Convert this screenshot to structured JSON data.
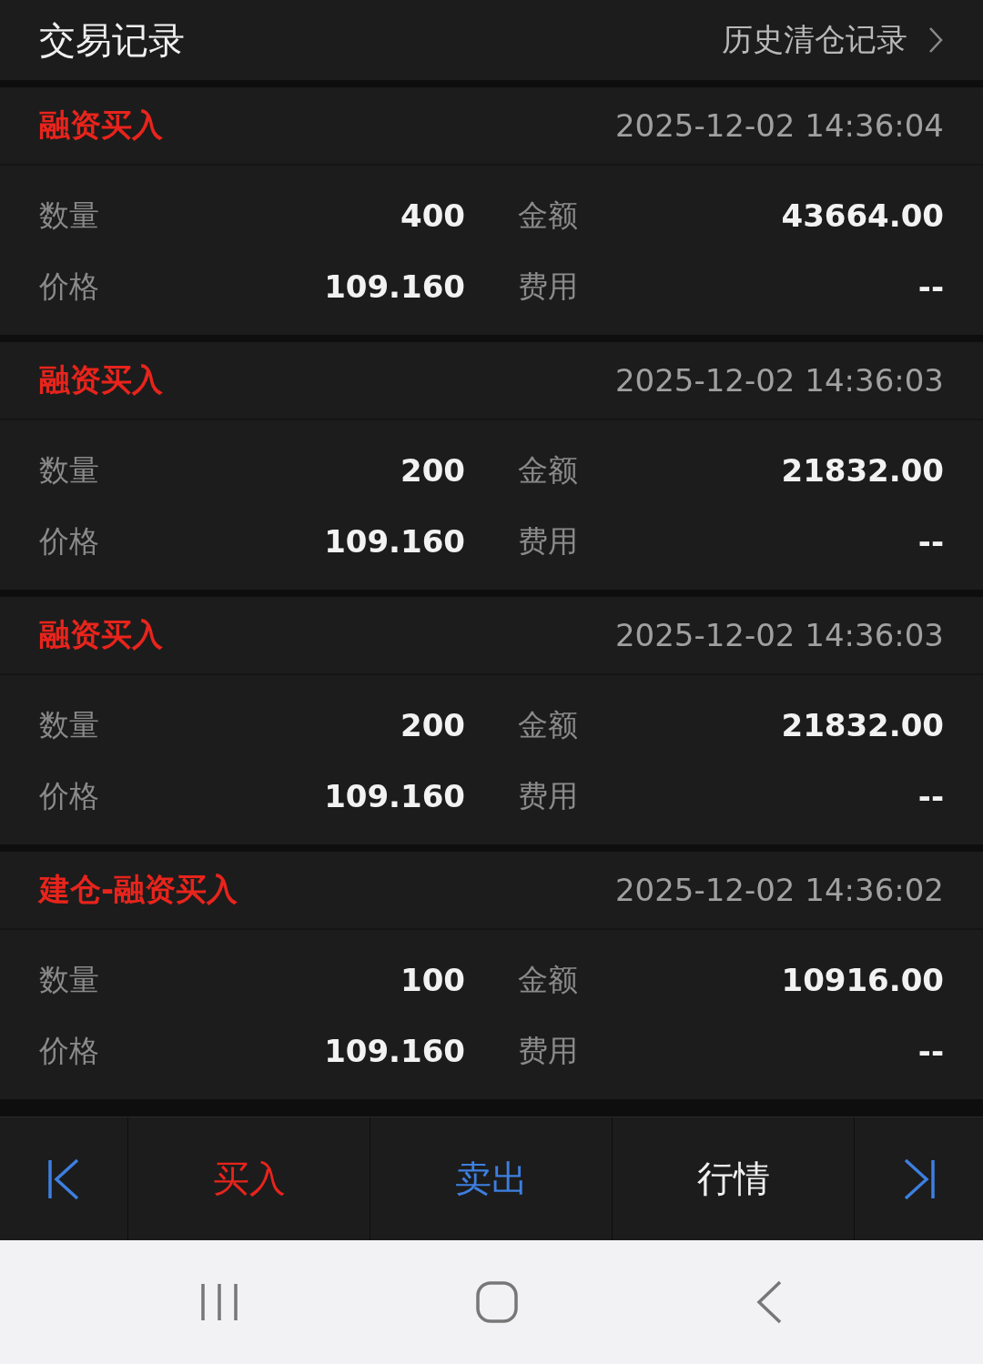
{
  "header": {
    "title": "交易记录",
    "link": "历史清仓记录"
  },
  "records": [
    {
      "type": "融资买入",
      "time": "2025-12-02 14:36:04",
      "fields": [
        {
          "label": "数量",
          "value": "400"
        },
        {
          "label": "金额",
          "value": "43664.00"
        },
        {
          "label": "价格",
          "value": "109.160"
        },
        {
          "label": "费用",
          "value": "--"
        }
      ]
    },
    {
      "type": "融资买入",
      "time": "2025-12-02 14:36:03",
      "fields": [
        {
          "label": "数量",
          "value": "200"
        },
        {
          "label": "金额",
          "value": "21832.00"
        },
        {
          "label": "价格",
          "value": "109.160"
        },
        {
          "label": "费用",
          "value": "--"
        }
      ]
    },
    {
      "type": "融资买入",
      "time": "2025-12-02 14:36:03",
      "fields": [
        {
          "label": "数量",
          "value": "200"
        },
        {
          "label": "金额",
          "value": "21832.00"
        },
        {
          "label": "价格",
          "value": "109.160"
        },
        {
          "label": "费用",
          "value": "--"
        }
      ]
    },
    {
      "type": "建仓-融资买入",
      "time": "2025-12-02 14:36:02",
      "fields": [
        {
          "label": "数量",
          "value": "100"
        },
        {
          "label": "金额",
          "value": "10916.00"
        },
        {
          "label": "价格",
          "value": "109.160"
        },
        {
          "label": "费用",
          "value": "--"
        }
      ]
    }
  ],
  "toolbar": [
    {
      "kind": "first"
    },
    {
      "kind": "buy",
      "label": "买入"
    },
    {
      "kind": "sell",
      "label": "卖出"
    },
    {
      "kind": "neutral",
      "label": "行情"
    },
    {
      "kind": "last"
    }
  ]
}
